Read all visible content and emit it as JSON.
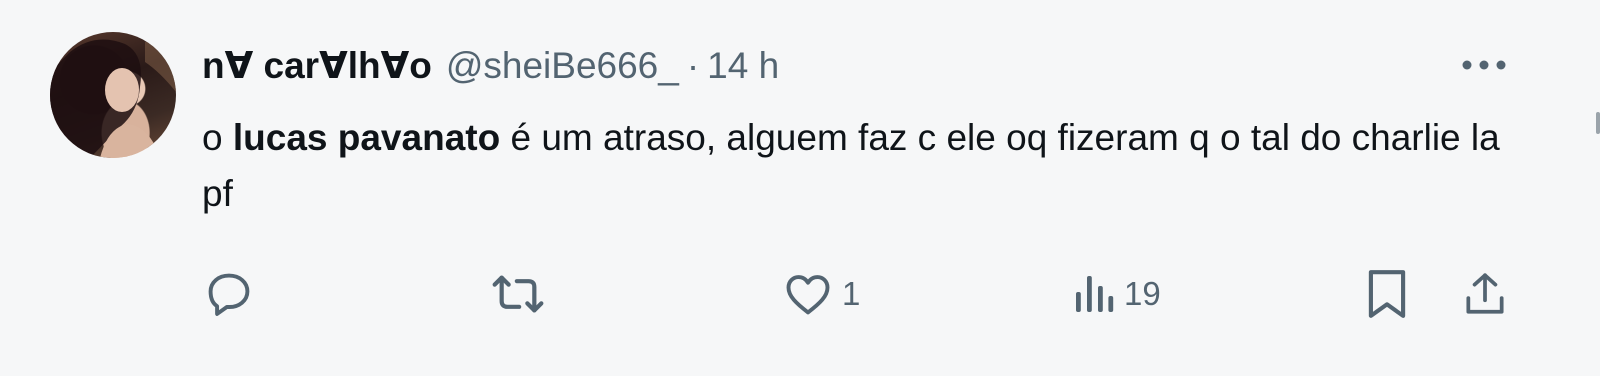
{
  "tweet": {
    "author": {
      "display_name": "n∀ car∀lh∀o",
      "handle": "@sheiBe666_",
      "separator": "·",
      "time": "14 h"
    },
    "text": {
      "part1": "o ",
      "mention": "lucas pavanato",
      "part2": " é um atraso, alguem faz c ele oq fizeram q o tal do charlie la pf"
    },
    "actions": {
      "reply_count": "",
      "retweet_count": "",
      "like_count": "1",
      "views_count": "19"
    }
  },
  "icons": {
    "more": "more-dots-icon",
    "reply": "reply-icon",
    "retweet": "retweet-icon",
    "like": "heart-icon",
    "views": "views-chart-icon",
    "bookmark": "bookmark-icon",
    "share": "share-icon"
  },
  "colors": {
    "background": "#f6f7f8",
    "text": "#0f1419",
    "secondary": "#536471"
  }
}
